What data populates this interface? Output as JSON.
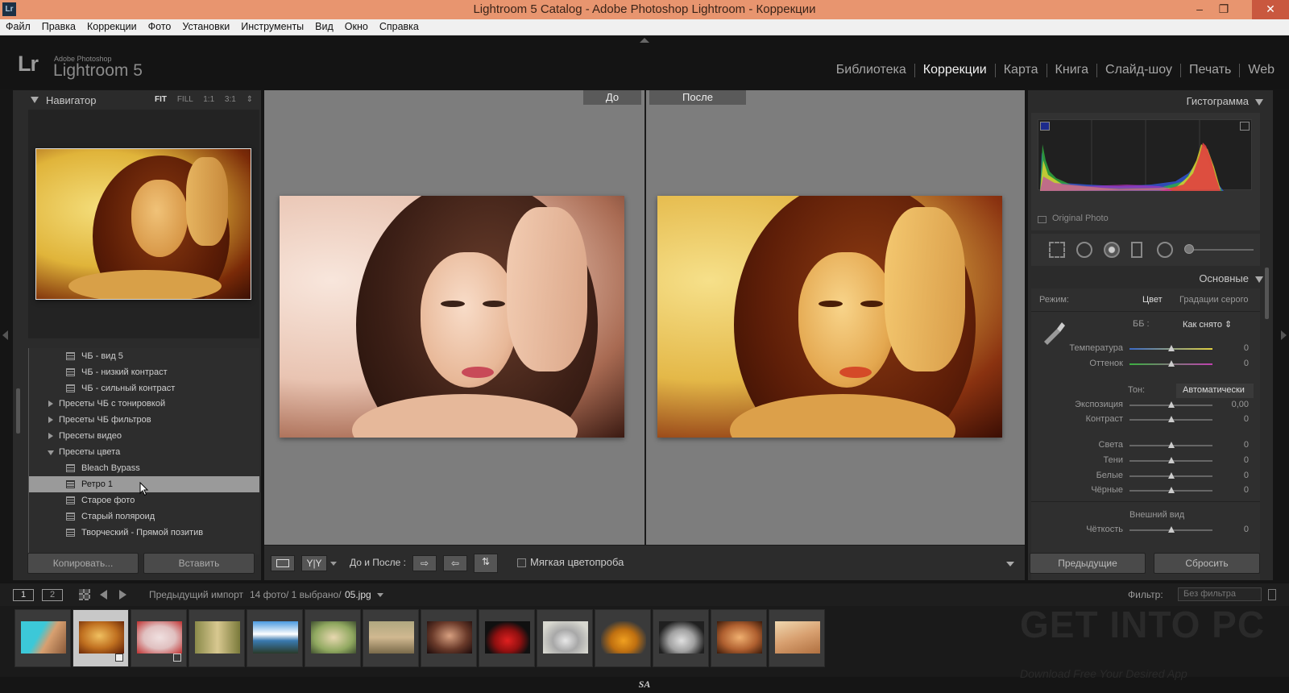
{
  "window": {
    "title": "Lightroom 5 Catalog - Adobe Photoshop Lightroom - Коррекции",
    "app_badge": "Lr",
    "minimize": "–",
    "restore": "❐",
    "close": "✕"
  },
  "menu": [
    "Файл",
    "Правка",
    "Коррекции",
    "Фото",
    "Установки",
    "Инструменты",
    "Вид",
    "Окно",
    "Справка"
  ],
  "identity": {
    "logo": "Lr",
    "brand_small": "Adobe Photoshop",
    "brand": "Lightroom 5"
  },
  "modules": [
    {
      "label": "Библиотека",
      "active": false
    },
    {
      "label": "Коррекции",
      "active": true
    },
    {
      "label": "Карта",
      "active": false
    },
    {
      "label": "Книга",
      "active": false
    },
    {
      "label": "Слайд-шоу",
      "active": false
    },
    {
      "label": "Печать",
      "active": false
    },
    {
      "label": "Web",
      "active": false
    }
  ],
  "navigator": {
    "title": "Навигатор",
    "zoom": [
      "FIT",
      "FILL",
      "1:1",
      "3:1"
    ],
    "zoom_selected": "FIT",
    "stepper": "⇕"
  },
  "presets": [
    {
      "label": "ЧБ - вид 5",
      "kind": "item"
    },
    {
      "label": "ЧБ - низкий контраст",
      "kind": "item"
    },
    {
      "label": "ЧБ - сильный контраст",
      "kind": "item"
    },
    {
      "label": "Пресеты ЧБ с тонировкой",
      "kind": "folder",
      "open": false
    },
    {
      "label": "Пресеты ЧБ фильтров",
      "kind": "folder",
      "open": false
    },
    {
      "label": "Пресеты видео",
      "kind": "folder",
      "open": false
    },
    {
      "label": "Пресеты цвета",
      "kind": "folder",
      "open": true
    },
    {
      "label": "Bleach Bypass",
      "kind": "item"
    },
    {
      "label": "Ретро 1",
      "kind": "item",
      "selected": true
    },
    {
      "label": "Старое фото",
      "kind": "item"
    },
    {
      "label": "Старый поляроид",
      "kind": "item"
    },
    {
      "label": "Творческий - Прямой позитив",
      "kind": "item"
    }
  ],
  "left_buttons": {
    "copy": "Копировать...",
    "paste": "Вставить"
  },
  "compare": {
    "before": "До",
    "after": "После"
  },
  "toolbar": {
    "yy": "Y|Y",
    "before_after_label": "До и После :",
    "soft_proof": "Мягкая цветопроба"
  },
  "histogram": {
    "title": "Гистограмма",
    "original_photo": "Original Photo"
  },
  "basic": {
    "title": "Основные",
    "mode_label": "Режим:",
    "mode_color": "Цвет",
    "mode_gray": "Градации серого",
    "wb_label": "ББ :",
    "wb_value": "Как снято ⇕",
    "temp": {
      "label": "Температура",
      "value": "0"
    },
    "tint": {
      "label": "Оттенок",
      "value": "0"
    },
    "tone_label": "Тон:",
    "auto": "Автоматически",
    "exposure": {
      "label": "Экспозиция",
      "value": "0,00"
    },
    "contrast": {
      "label": "Контраст",
      "value": "0"
    },
    "highlights": {
      "label": "Света",
      "value": "0"
    },
    "shadows": {
      "label": "Тени",
      "value": "0"
    },
    "whites": {
      "label": "Белые",
      "value": "0"
    },
    "blacks": {
      "label": "Чёрные",
      "value": "0"
    },
    "presence": "Внешний вид",
    "clarity": {
      "label": "Чёткость",
      "value": "0"
    }
  },
  "right_buttons": {
    "previous": "Предыдущие",
    "reset": "Сбросить"
  },
  "filmbar": {
    "page1": "1",
    "page2": "2",
    "source": "Предыдущий импорт",
    "count": "14 фото/  1 выбрано/",
    "filename": "05.jpg",
    "filter_label": "Фильтр:",
    "filter_value": "Без фильтра"
  },
  "watermark": {
    "line1": "GET INTO PC",
    "line2": "Download Free Your Desired App"
  },
  "footer": "SA",
  "colors": {
    "accent_title": "#e8956f",
    "panel_bg": "#2b2b2b",
    "pane_bg": "#7d7d7d"
  }
}
